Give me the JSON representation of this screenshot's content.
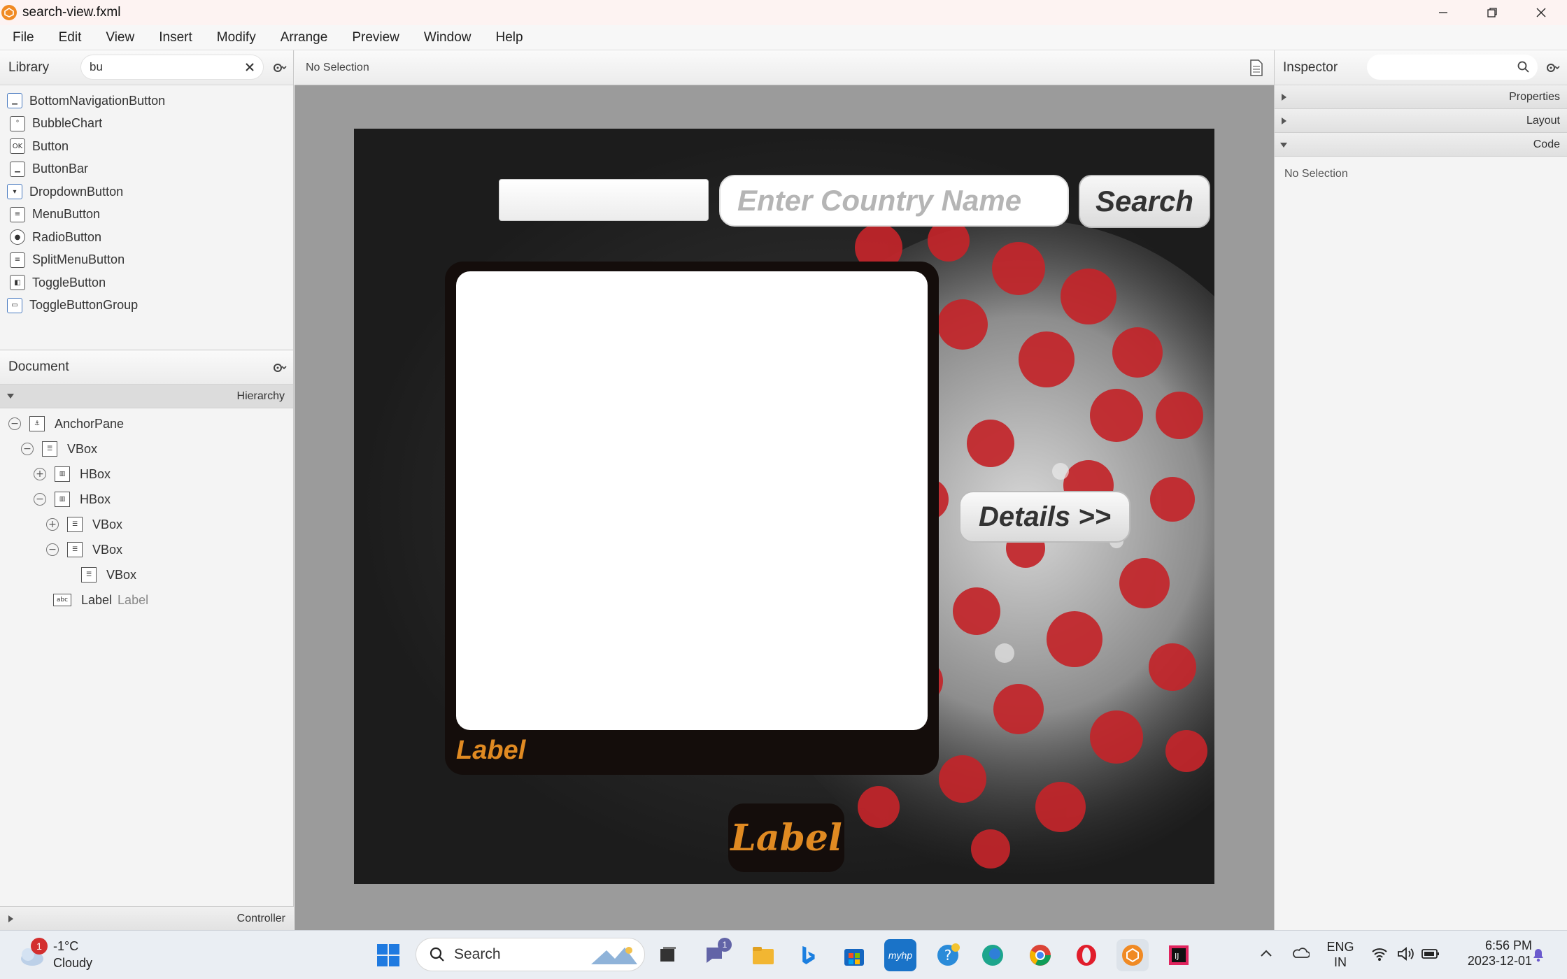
{
  "window": {
    "title": "search-view.fxml"
  },
  "menu": [
    "File",
    "Edit",
    "View",
    "Insert",
    "Modify",
    "Arrange",
    "Preview",
    "Window",
    "Help"
  ],
  "library": {
    "title": "Library",
    "search_value": "bu",
    "items": [
      {
        "label": "BottomNavigationButton",
        "icon": "bottom-nav-button-icon"
      },
      {
        "label": "BubbleChart",
        "icon": "bubble-chart-icon"
      },
      {
        "label": "Button",
        "icon": "ok-button-icon"
      },
      {
        "label": "ButtonBar",
        "icon": "button-bar-icon"
      },
      {
        "label": "DropdownButton",
        "icon": "dropdown-button-icon"
      },
      {
        "label": "MenuButton",
        "icon": "menu-button-icon"
      },
      {
        "label": "RadioButton",
        "icon": "radio-button-icon"
      },
      {
        "label": "SplitMenuButton",
        "icon": "split-menu-button-icon"
      },
      {
        "label": "ToggleButton",
        "icon": "toggle-button-icon"
      },
      {
        "label": "ToggleButtonGroup",
        "icon": "toggle-button-group-icon"
      }
    ]
  },
  "document": {
    "title": "Document",
    "hierarchy_label": "Hierarchy",
    "tree": [
      {
        "label": "AnchorPane",
        "toggle": "−",
        "icon": "anchor-pane-icon"
      },
      {
        "label": "VBox",
        "toggle": "−",
        "icon": "vbox-icon"
      },
      {
        "label": "HBox",
        "toggle": "+",
        "icon": "hbox-icon"
      },
      {
        "label": "HBox",
        "toggle": "−",
        "icon": "hbox-icon"
      },
      {
        "label": "VBox",
        "toggle": "+",
        "icon": "vbox-icon"
      },
      {
        "label": "VBox",
        "toggle": "−",
        "icon": "vbox-icon"
      },
      {
        "label": "VBox",
        "toggle": "",
        "icon": "vbox-icon"
      },
      {
        "label": "Label",
        "sub": "Label",
        "toggle": "",
        "icon": "label-icon"
      }
    ],
    "controller_label": "Controller"
  },
  "canvas": {
    "selection": "No Selection",
    "country_placeholder": "Enter Country Name",
    "search_button": "Search",
    "card_label": "Label",
    "details_button": "Details >>",
    "bottom_label": "Label"
  },
  "inspector": {
    "title": "Inspector",
    "sections": [
      "Properties",
      "Layout",
      "Code"
    ],
    "no_selection": "No Selection"
  },
  "taskbar": {
    "weather_temp": "-1°C",
    "weather_cond": "Cloudy",
    "weather_badge": "1",
    "search_label": "Search",
    "teams_badge": "1",
    "lang": "ENG",
    "region": "IN",
    "time": "6:56 PM",
    "date": "2023-12-01"
  },
  "colors": {
    "accent_orange": "#e08a22",
    "card_dark": "#140d0b"
  }
}
